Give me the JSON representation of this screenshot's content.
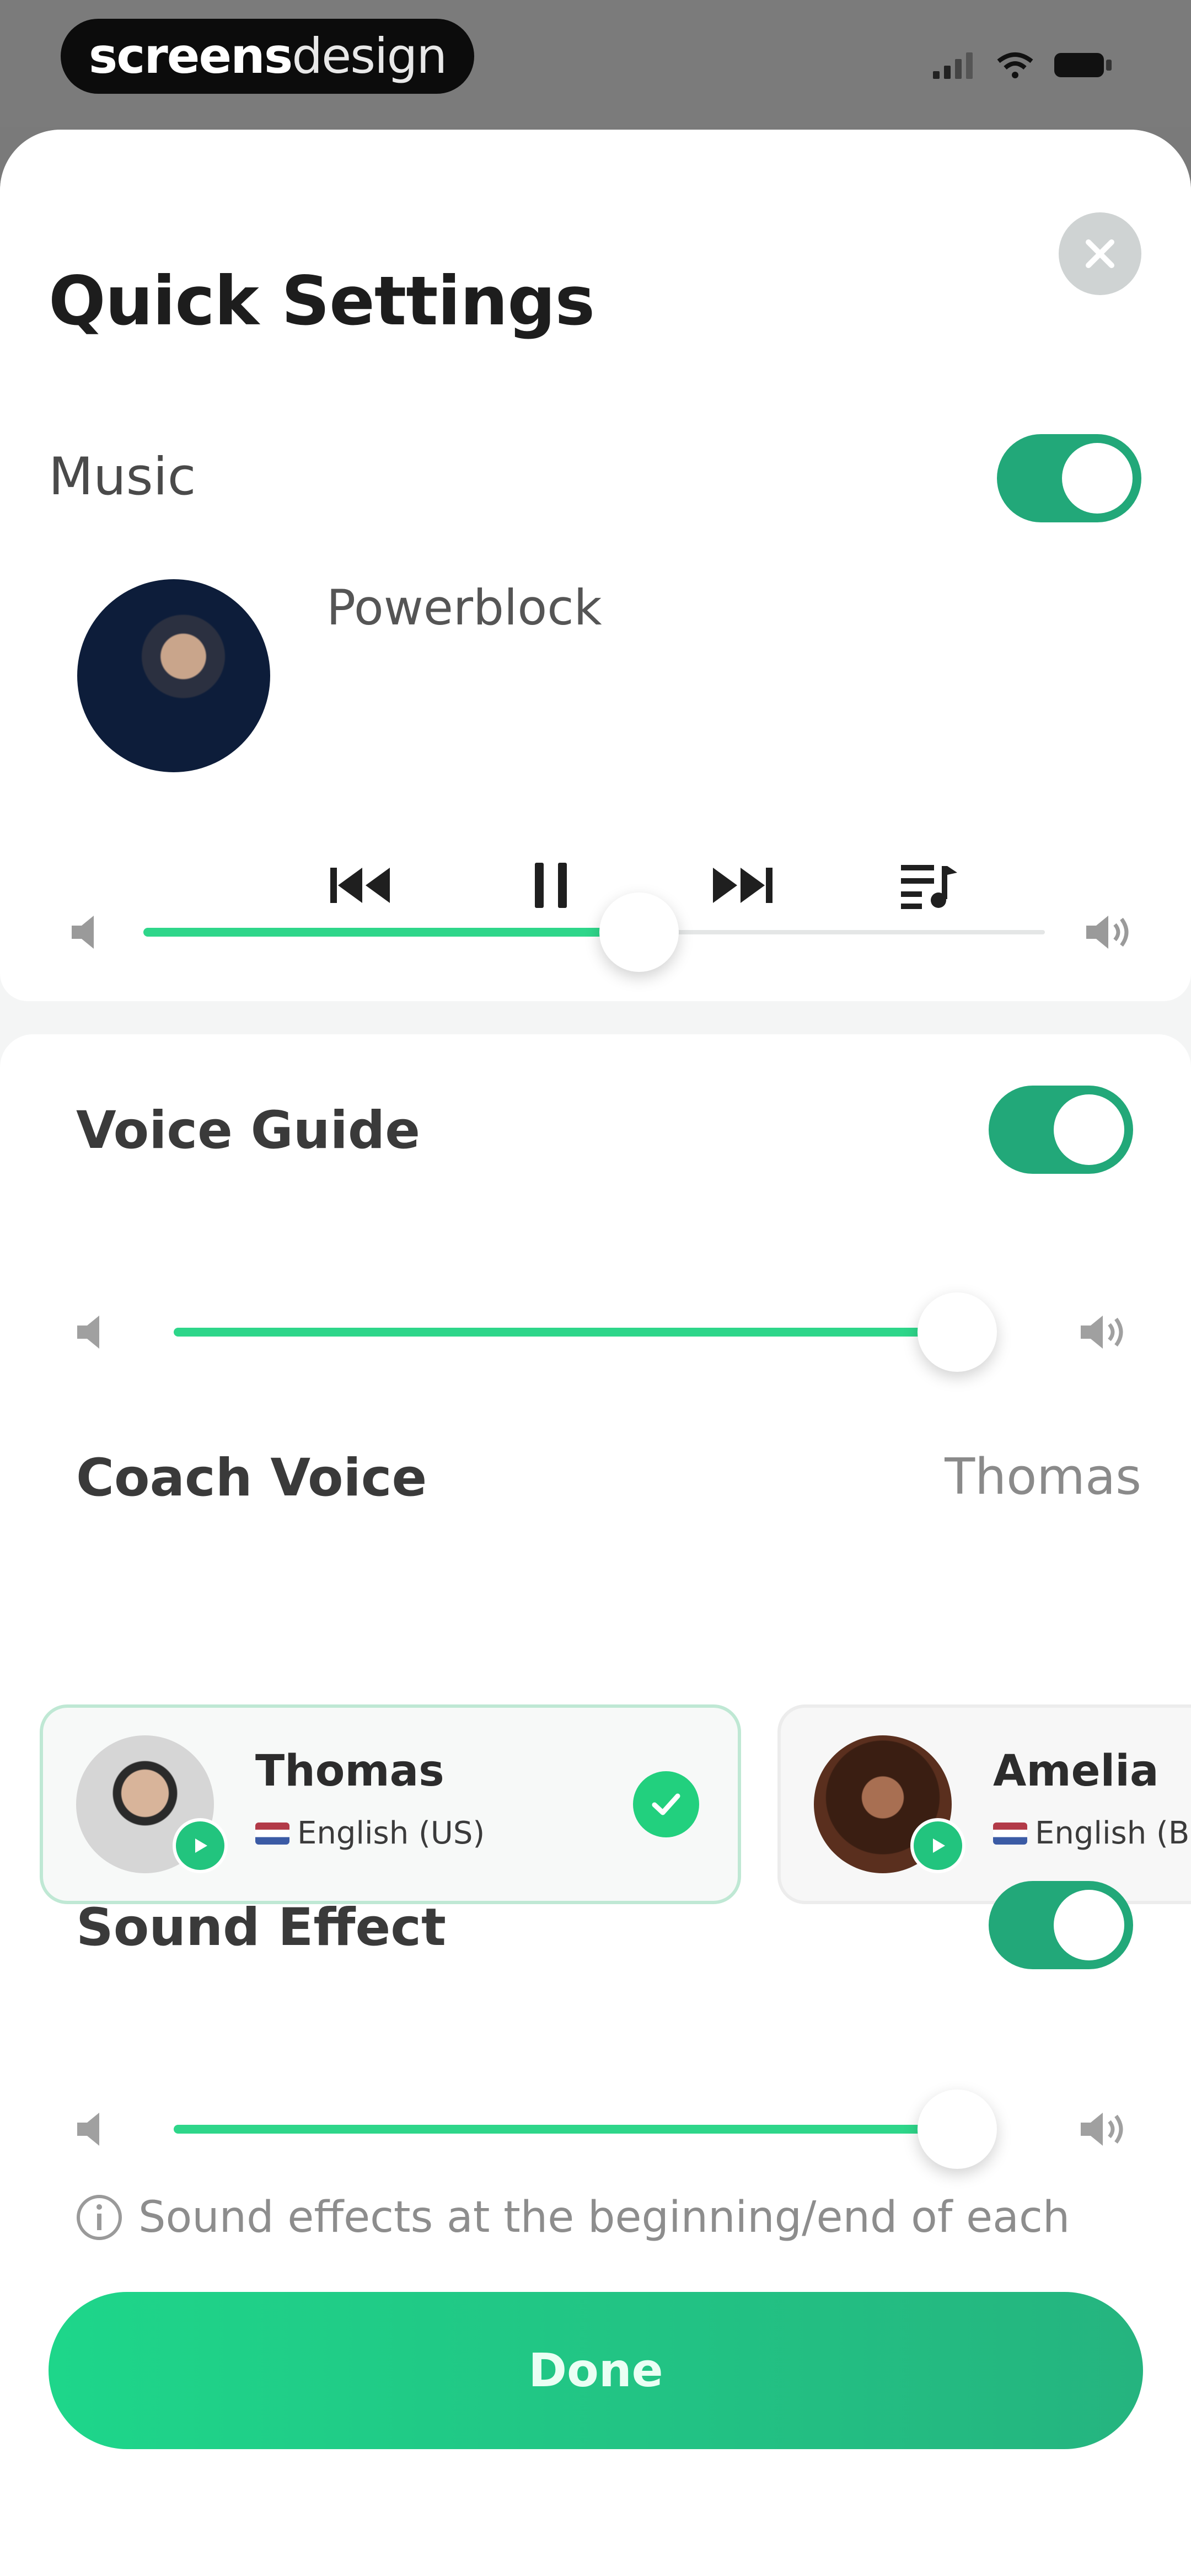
{
  "status_bar": {
    "brand_bold": "screens",
    "brand_light": "design",
    "icons": [
      "signal-icon",
      "wifi-icon",
      "battery-icon"
    ]
  },
  "sheet": {
    "title": "Quick Settings",
    "close_icon": "close-icon"
  },
  "music": {
    "label": "Music",
    "enabled": true,
    "track_title": "Powerblock",
    "controls": [
      "previous-icon",
      "pause-icon",
      "next-icon",
      "playlist-icon"
    ],
    "volume": 0.55
  },
  "voice_guide": {
    "label": "Voice Guide",
    "enabled": true,
    "volume": 0.97
  },
  "coach_voice": {
    "label": "Coach Voice",
    "selected": "Thomas",
    "coaches": [
      {
        "name": "Thomas",
        "language": "English (US)",
        "selected": true
      },
      {
        "name": "Amelia",
        "language": "English (B",
        "selected": false
      }
    ]
  },
  "sound_effect": {
    "label": "Sound Effect",
    "enabled": true,
    "volume": 0.97,
    "note": "Sound effects at the beginning/end of each"
  },
  "done_button": {
    "label": "Done"
  },
  "colors": {
    "accent": "#22a879",
    "slider_fill": "#2ed68a",
    "done_start": "#1ed68a",
    "done_end": "#25b47f"
  }
}
